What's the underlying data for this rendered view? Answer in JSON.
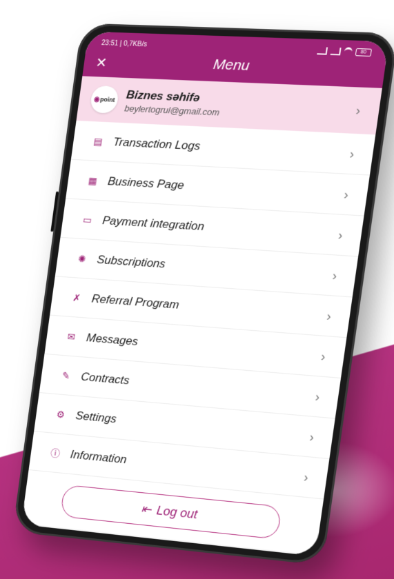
{
  "status_bar": {
    "time": "23:51 | 0,7KB/s",
    "battery": "80"
  },
  "header": {
    "title": "Menu"
  },
  "profile": {
    "logo_text": "point",
    "name": "Biznes səhifə",
    "email": "beylertogrul@gmail.com"
  },
  "menu": {
    "items": [
      {
        "label": "Transaction Logs",
        "icon": "document-icon"
      },
      {
        "label": "Business Page",
        "icon": "page-icon"
      },
      {
        "label": "Payment integration",
        "icon": "card-icon"
      },
      {
        "label": "Subscriptions",
        "icon": "people-icon"
      },
      {
        "label": "Referral Program",
        "icon": "referral-icon"
      },
      {
        "label": "Messages",
        "icon": "mail-icon"
      },
      {
        "label": "Contracts",
        "icon": "pen-icon"
      },
      {
        "label": "Settings",
        "icon": "gear-icon"
      },
      {
        "label": "Information",
        "icon": "info-icon"
      }
    ]
  },
  "logout": {
    "label": "Log out"
  },
  "colors": {
    "brand": "#9e2377",
    "profile_bg": "#f8dbe9",
    "background_band": "#b5317f"
  }
}
